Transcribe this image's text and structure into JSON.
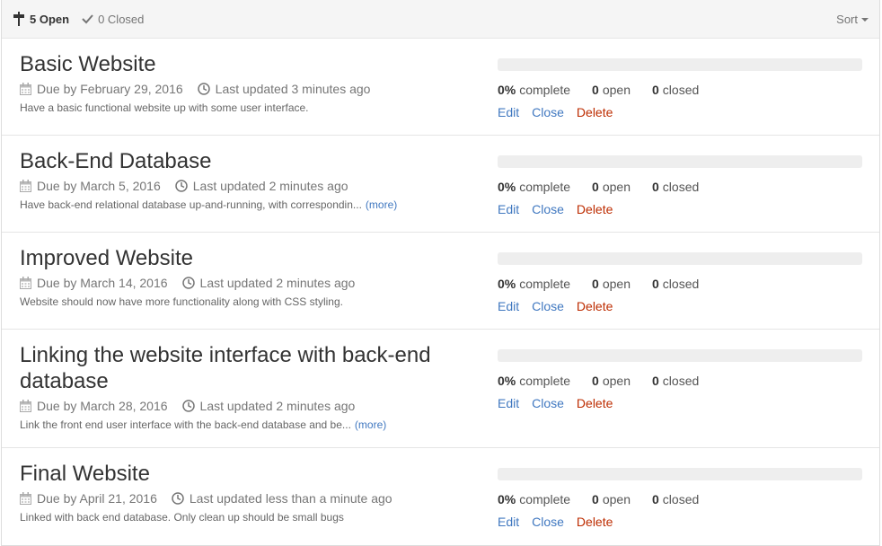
{
  "header": {
    "open_count_label": "5 Open",
    "closed_count_label": "0 Closed",
    "sort_label": "Sort"
  },
  "milestones": [
    {
      "title": "Basic Website",
      "due": "Due by February 29, 2016",
      "updated": "Last updated 3 minutes ago",
      "description": "Have a basic functional website up with some user interface.",
      "more": "",
      "progress_percent": 0,
      "complete_value": "0%",
      "complete_label": "complete",
      "open_value": "0",
      "open_label": "open",
      "closed_value": "0",
      "closed_label": "closed"
    },
    {
      "title": "Back-End Database",
      "due": "Due by March 5, 2016",
      "updated": "Last updated 2 minutes ago",
      "description": "Have back-end relational database up-and-running, with correspondin...",
      "more": "(more)",
      "progress_percent": 0,
      "complete_value": "0%",
      "complete_label": "complete",
      "open_value": "0",
      "open_label": "open",
      "closed_value": "0",
      "closed_label": "closed"
    },
    {
      "title": "Improved Website",
      "due": "Due by March 14, 2016",
      "updated": "Last updated 2 minutes ago",
      "description": "Website should now have more functionality along with CSS styling.",
      "more": "",
      "progress_percent": 0,
      "complete_value": "0%",
      "complete_label": "complete",
      "open_value": "0",
      "open_label": "open",
      "closed_value": "0",
      "closed_label": "closed"
    },
    {
      "title": "Linking the website interface with back-end database",
      "due": "Due by March 28, 2016",
      "updated": "Last updated 2 minutes ago",
      "description": "Link the front end user interface with the back-end database and be...",
      "more": "(more)",
      "progress_percent": 0,
      "complete_value": "0%",
      "complete_label": "complete",
      "open_value": "0",
      "open_label": "open",
      "closed_value": "0",
      "closed_label": "closed"
    },
    {
      "title": "Final Website",
      "due": "Due by April 21, 2016",
      "updated": "Last updated less than a minute ago",
      "description": "Linked with back end database. Only clean up should be small bugs",
      "more": "",
      "progress_percent": 0,
      "complete_value": "0%",
      "complete_label": "complete",
      "open_value": "0",
      "open_label": "open",
      "closed_value": "0",
      "closed_label": "closed"
    }
  ],
  "actions": {
    "edit": "Edit",
    "close": "Close",
    "delete": "Delete"
  },
  "icons": {
    "milestone": "milestone-icon",
    "check": "check-icon",
    "calendar": "calendar-icon",
    "clock": "clock-icon",
    "caret": "caret-down-icon"
  },
  "colors": {
    "link": "#4078c0",
    "danger": "#bd2c00",
    "progress_track": "#eeeeee"
  }
}
